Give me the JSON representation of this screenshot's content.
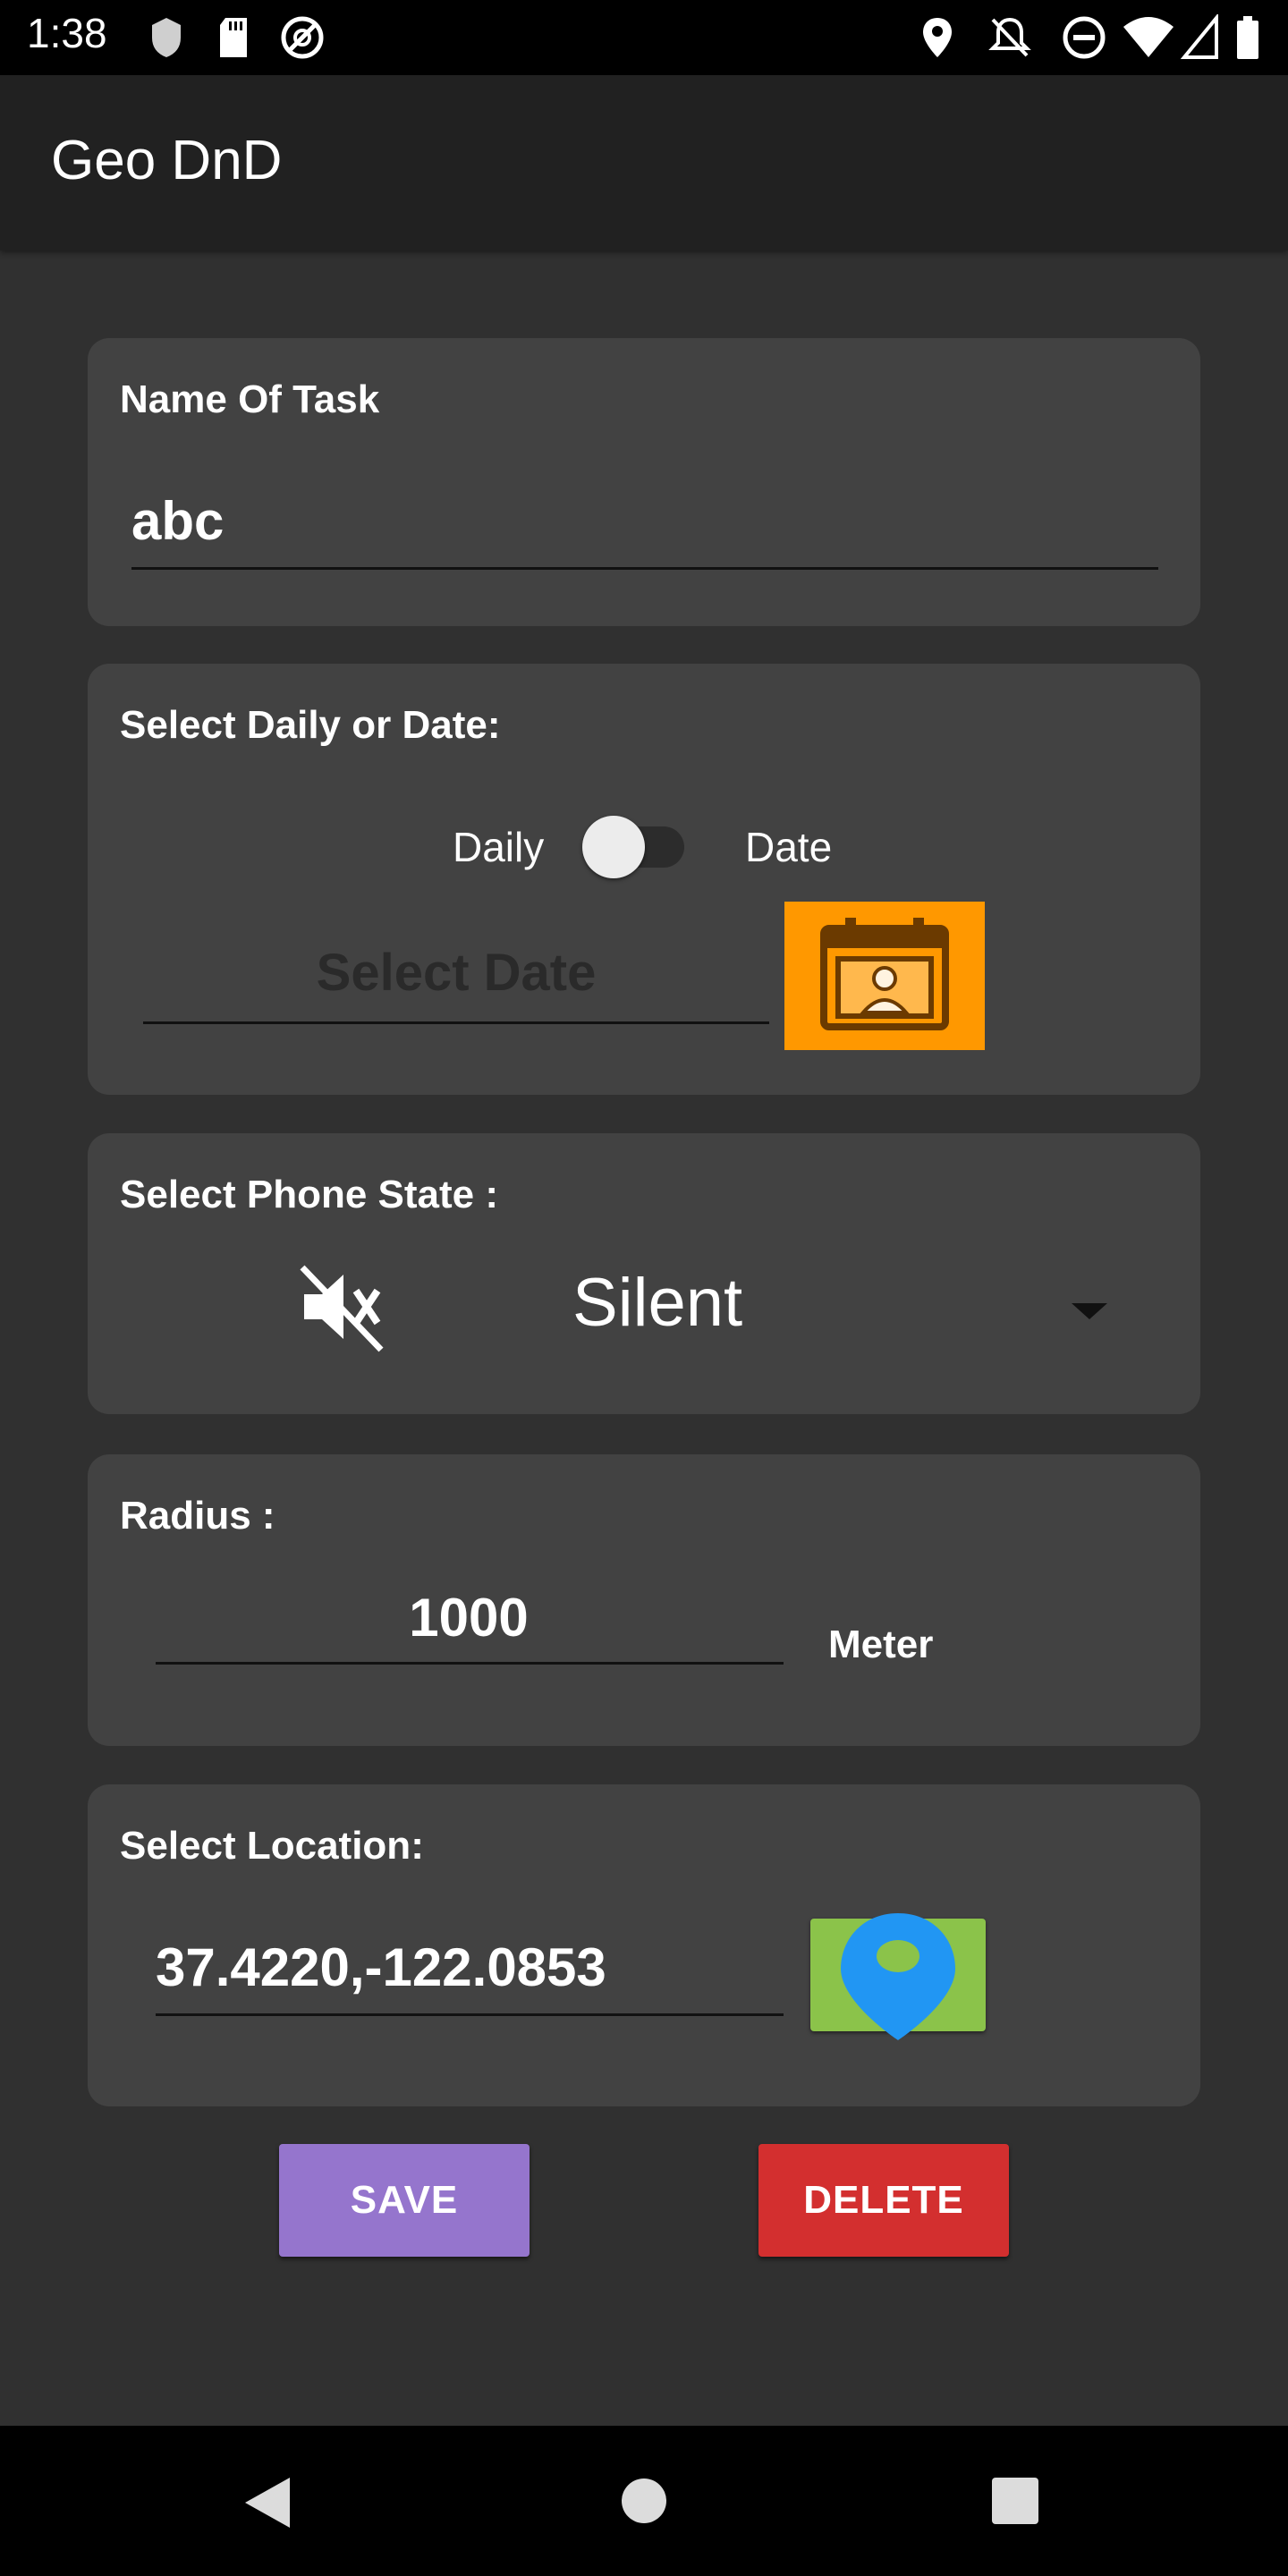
{
  "status_bar": {
    "time": "1:38"
  },
  "app": {
    "title": "Geo DnD"
  },
  "task_card": {
    "label": "Name Of Task",
    "value": "abc"
  },
  "schedule_card": {
    "label": "Select Daily or Date:",
    "daily_label": "Daily",
    "date_label": "Date",
    "toggle_on": false,
    "date_placeholder": "Select Date"
  },
  "phone_state_card": {
    "label": "Select Phone State :",
    "selected": "Silent"
  },
  "radius_card": {
    "label": "Radius :",
    "value": "1000",
    "unit": "Meter"
  },
  "location_card": {
    "label": "Select Location:",
    "value": "37.4220,-122.0853"
  },
  "buttons": {
    "save": "SAVE",
    "delete": "DELETE"
  },
  "colors": {
    "accent_save": "#9575CD",
    "accent_delete": "#D32F2F",
    "calendar_button": "#FF9800",
    "map_button": "#8BC34A",
    "pin": "#2196F3"
  }
}
